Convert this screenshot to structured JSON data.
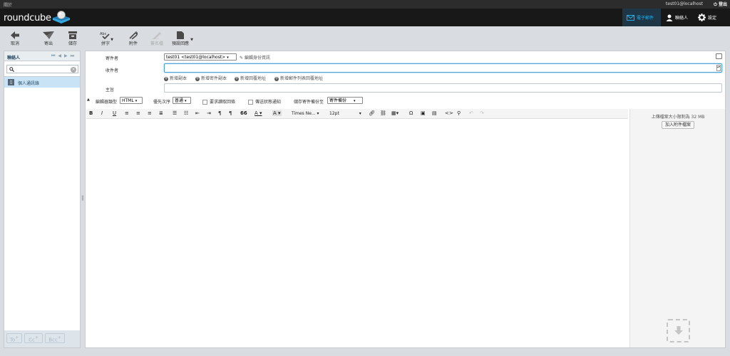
{
  "topbar": {
    "about": "關於",
    "user": "test01@localhost",
    "logout": "登出"
  },
  "header": {
    "logo": "roundcube"
  },
  "nav": {
    "mail": "電子郵件",
    "contacts": "聯絡人",
    "settings": "設定"
  },
  "toolbar": {
    "cancel": "取消",
    "send": "寄出",
    "save": "儲存",
    "spell": "拼字",
    "attach": "附件",
    "signature": "簽名檔",
    "responses": "預設回應",
    "spell_icon": "Abc"
  },
  "leftpanel": {
    "title": "聯絡人",
    "search_placeholder": "",
    "addressbook": "個人通訊錄",
    "recipient_to": "To",
    "recipient_cc": "Cc",
    "recipient_bcc": "Bcc"
  },
  "compose": {
    "from_label": "寄件者",
    "from_value": "test01 <test01@localhost>",
    "edit_identity": "編輯身份資訊",
    "to_label": "收件者",
    "add_cc": "新增副本",
    "add_bcc": "新增密件副本",
    "add_replyto": "新增回覆地址",
    "add_followupto": "新增郵件列表回覆地址",
    "subject_label": "主旨",
    "subject_value": "",
    "editor_type_label": "編輯器類型",
    "editor_type_value": "HTML",
    "priority_label": "優先次序",
    "priority_value": "普通",
    "receipt_label": "要求讀取回條",
    "dsn_label": "傳送狀態通知",
    "savecopy_label": "儲存寄件備份至",
    "savecopy_value": "寄件備份"
  },
  "editor_toolbar": {
    "bold": "B",
    "italic": "I",
    "underline": "U",
    "font_family": "Times Ne...",
    "font_size": "12pt",
    "blockquote": "66",
    "charmap": "Ω",
    "code": "<>"
  },
  "attachments": {
    "max_size_text": "上傳檔案大小限制為 32 MB",
    "add_button": "加入附件檔案"
  },
  "colors": {
    "accent": "#1fb0f0",
    "header_bg": "#181818",
    "selected_row": "#c7e3f5",
    "focus_border": "#4aa0d4"
  }
}
